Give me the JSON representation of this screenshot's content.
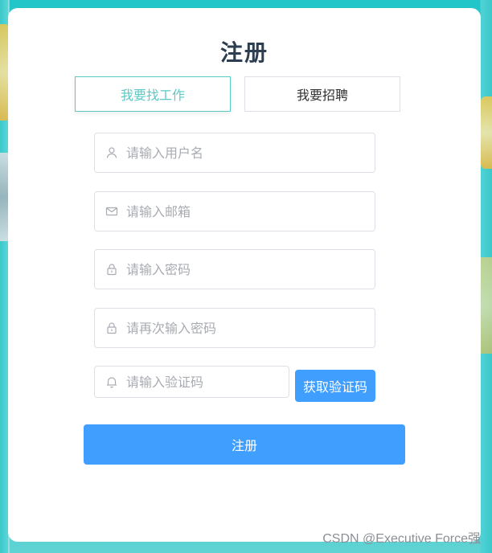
{
  "form": {
    "title": "注册",
    "role_tabs": [
      {
        "label": "我要找工作",
        "active": true
      },
      {
        "label": "我要招聘",
        "active": false
      }
    ],
    "fields": {
      "username": {
        "placeholder": "请输入用户名",
        "value": "",
        "icon": "user-icon"
      },
      "email": {
        "placeholder": "请输入邮箱",
        "value": "",
        "icon": "mail-icon"
      },
      "password": {
        "placeholder": "请输入密码",
        "value": "",
        "icon": "lock-icon"
      },
      "confirm_password": {
        "placeholder": "请再次输入密码",
        "value": "",
        "icon": "lock-icon"
      },
      "code": {
        "placeholder": "请输入验证码",
        "value": "",
        "icon": "bell-icon"
      }
    },
    "get_code_label": "获取验证码",
    "submit_label": "注册"
  },
  "watermark": "CSDN @Executive Force强",
  "colors": {
    "accent": "#409eff",
    "active_tab": "#5bc9c6",
    "title": "#2c3e50",
    "border": "#dcdfe6",
    "placeholder": "#a8abb2"
  }
}
